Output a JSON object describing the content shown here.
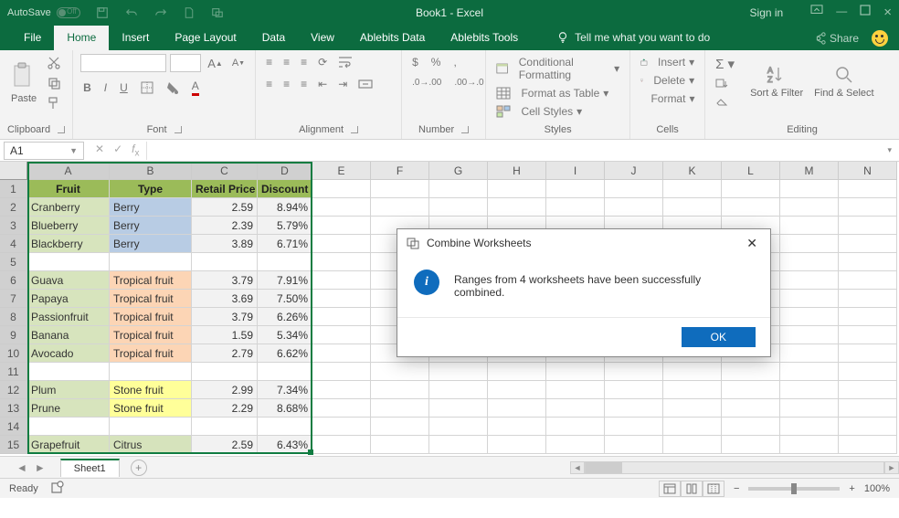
{
  "titlebar": {
    "autosave": "AutoSave",
    "off": "Off",
    "title": "Book1 - Excel",
    "signin": "Sign in"
  },
  "tabs": {
    "file": "File",
    "home": "Home",
    "insert": "Insert",
    "pageLayout": "Page Layout",
    "data": "Data",
    "view": "View",
    "ablebitsData": "Ablebits Data",
    "ablebitsTools": "Ablebits Tools",
    "tellme": "Tell me what you want to do",
    "share": "Share"
  },
  "ribbon": {
    "clipboard": {
      "label": "Clipboard",
      "paste": "Paste"
    },
    "font": {
      "label": "Font"
    },
    "alignment": {
      "label": "Alignment"
    },
    "number": {
      "label": "Number",
      "currency": "$",
      "percent": "%",
      "comma": ","
    },
    "styles": {
      "label": "Styles",
      "condFmt": "Conditional Formatting",
      "fmtTable": "Format as Table",
      "cellStyles": "Cell Styles"
    },
    "cells": {
      "label": "Cells",
      "insert": "Insert",
      "delete": "Delete",
      "format": "Format"
    },
    "editing": {
      "label": "Editing",
      "sortFilter": "Sort & Filter",
      "findSelect": "Find & Select"
    }
  },
  "nameBox": "A1",
  "headers": {
    "fruit": "Fruit",
    "type": "Type",
    "price": "Retail Price",
    "disc": "Discount"
  },
  "cols": [
    "A",
    "B",
    "C",
    "D",
    "E",
    "F",
    "G",
    "H",
    "I",
    "J",
    "K",
    "L",
    "M",
    "N"
  ],
  "rows": [
    {
      "n": 2,
      "f": "Cranberry",
      "t": "Berry",
      "tc": "berry",
      "p": "2.59",
      "d": "8.94%"
    },
    {
      "n": 3,
      "f": "Blueberry",
      "t": "Berry",
      "tc": "berry",
      "p": "2.39",
      "d": "5.79%"
    },
    {
      "n": 4,
      "f": "Blackberry",
      "t": "Berry",
      "tc": "berry",
      "p": "3.89",
      "d": "6.71%"
    },
    {
      "n": 5,
      "blank": true
    },
    {
      "n": 6,
      "f": "Guava",
      "t": "Tropical fruit",
      "tc": "trop",
      "p": "3.79",
      "d": "7.91%"
    },
    {
      "n": 7,
      "f": "Papaya",
      "t": "Tropical fruit",
      "tc": "trop",
      "p": "3.69",
      "d": "7.50%"
    },
    {
      "n": 8,
      "f": "Passionfruit",
      "t": "Tropical fruit",
      "tc": "trop",
      "p": "3.79",
      "d": "6.26%"
    },
    {
      "n": 9,
      "f": "Banana",
      "t": "Tropical fruit",
      "tc": "trop",
      "p": "1.59",
      "d": "5.34%"
    },
    {
      "n": 10,
      "f": "Avocado",
      "t": "Tropical fruit",
      "tc": "trop",
      "p": "2.79",
      "d": "6.62%"
    },
    {
      "n": 11,
      "blank": true
    },
    {
      "n": 12,
      "f": "Plum",
      "t": "Stone fruit",
      "tc": "stone",
      "p": "2.99",
      "d": "7.34%"
    },
    {
      "n": 13,
      "f": "Prune",
      "t": "Stone fruit",
      "tc": "stone",
      "p": "2.29",
      "d": "8.68%"
    },
    {
      "n": 14,
      "blank": true
    },
    {
      "n": 15,
      "f": "Grapefruit",
      "t": "Citrus",
      "tc": "citr",
      "p": "2.59",
      "d": "6.43%"
    }
  ],
  "dialog": {
    "title": "Combine Worksheets",
    "message": "Ranges from 4 worksheets have been successfully combined.",
    "ok": "OK"
  },
  "sheet": {
    "name": "Sheet1"
  },
  "status": {
    "ready": "Ready",
    "zoom": "100%"
  }
}
